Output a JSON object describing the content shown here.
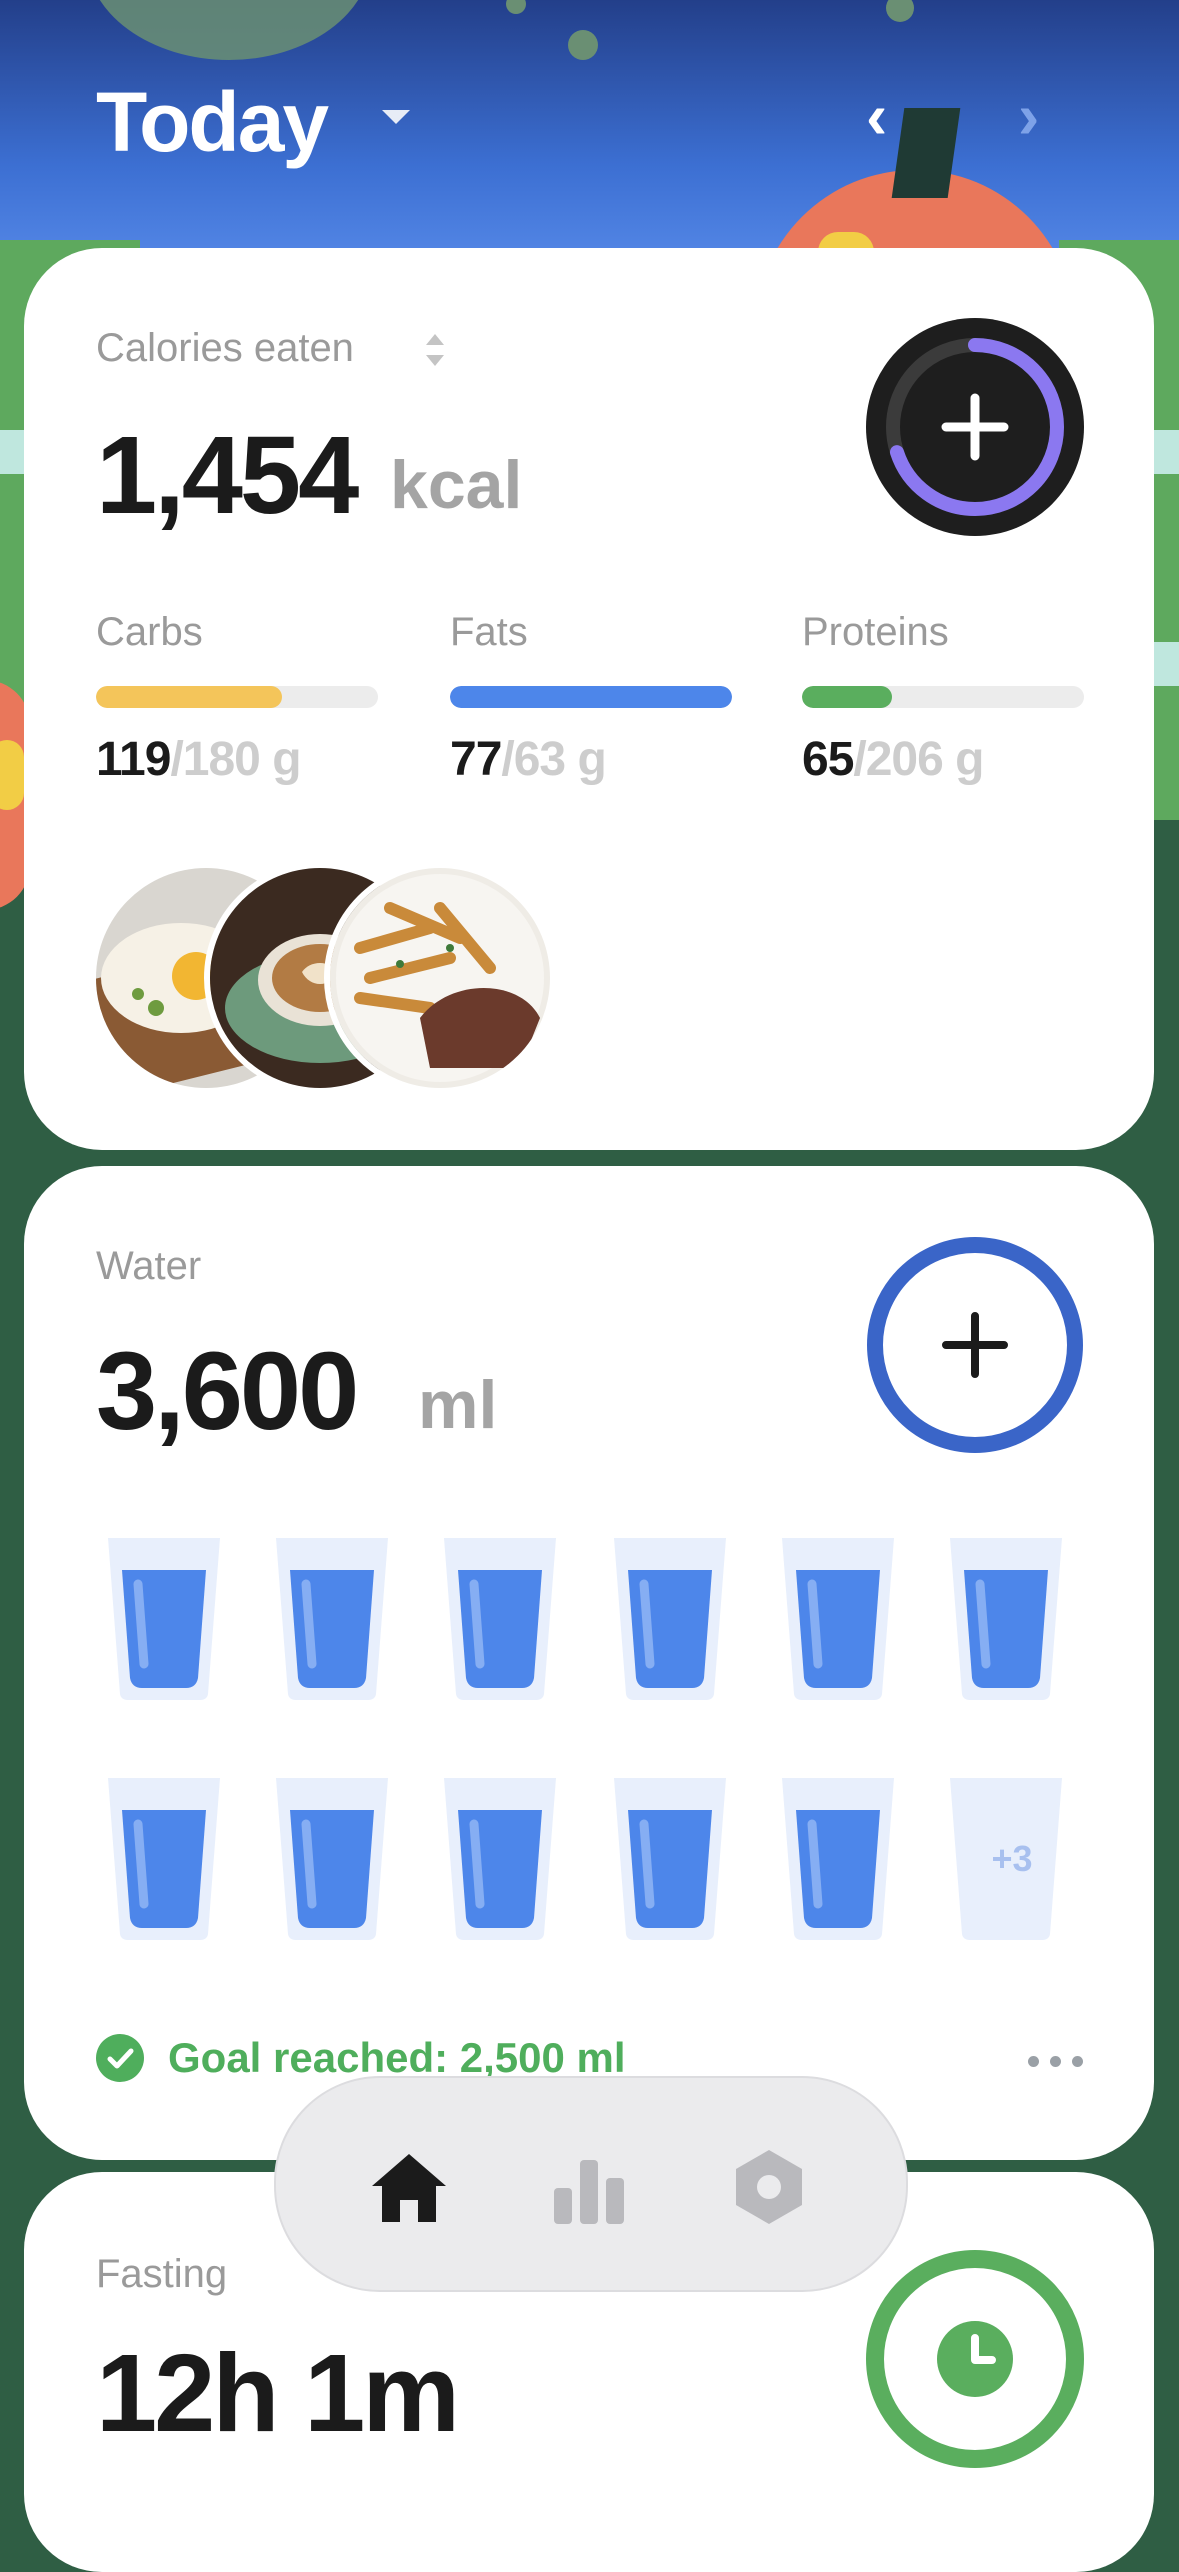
{
  "header": {
    "title": "Today"
  },
  "calories": {
    "label": "Calories eaten",
    "value": "1,454",
    "unit": "kcal",
    "progress": 0.7,
    "macros": [
      {
        "name": "Carbs",
        "eaten": "119",
        "goal": "/180 g",
        "progress": 0.66,
        "color": "#f4c55a"
      },
      {
        "name": "Fats",
        "eaten": "77",
        "goal": "/63 g",
        "progress": 1.0,
        "color": "#4d86ea"
      },
      {
        "name": "Proteins",
        "eaten": "65",
        "goal": "/206 g",
        "progress": 0.32,
        "color": "#5aae5e"
      }
    ],
    "meal_photos": [
      "egg-toast-photo",
      "latte-photo",
      "steak-fries-photo"
    ]
  },
  "water": {
    "label": "Water",
    "value": "3,600",
    "unit": "ml",
    "glasses_shown": 11,
    "extra_label": "+3",
    "goal_text": "Goal reached: 2,500 ml"
  },
  "fasting": {
    "label": "Fasting",
    "value": "12h 1m"
  },
  "tabbar": {
    "items": [
      "home-icon",
      "stats-icon",
      "settings-icon"
    ],
    "active": "home-icon"
  },
  "colors": {
    "accent_purple": "#8b78f0",
    "water_blue": "#3a65c8",
    "goal_green": "#4fae5c"
  }
}
